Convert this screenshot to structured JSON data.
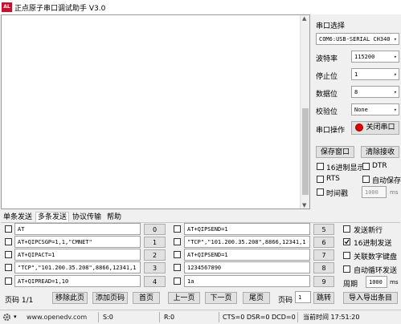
{
  "window": {
    "title": "正点原子串口调试助手 V3.0",
    "logo_text": "ALIENTEK"
  },
  "serial": {
    "section_title": "串口选择",
    "port": "COM6:USB-SERIAL CH340",
    "baud_label": "波特率",
    "baud": "115200",
    "stop_label": "停止位",
    "stop": "1",
    "data_label": "数据位",
    "data": "8",
    "parity_label": "校验位",
    "parity": "None",
    "op_label": "串口操作",
    "close_button": "关闭串口",
    "status_color": "#e00000"
  },
  "actions": {
    "save_window": "保存窗口",
    "clear_receive": "清除接收",
    "hex_display": "16进制显示",
    "dtr": "DTR",
    "rts": "RTS",
    "auto_save": "自动保存",
    "timestamp": "时间戳",
    "timestamp_value": "1000",
    "ms": "ms"
  },
  "tabs": [
    "单条发送",
    "多条发送",
    "协议传输",
    "帮助"
  ],
  "multi_send": {
    "rows": [
      {
        "text": "AT",
        "num": "0"
      },
      {
        "text": "AT+QIPCSGP=1,1,\"CMNET\"",
        "num": "1"
      },
      {
        "text": "AT+QIPACT=1",
        "num": "2"
      },
      {
        "text": "\"TCP\",\"101.200.35.208\",8866,12341,1",
        "num": "3"
      },
      {
        "text": "AT+QIPREAD=1,10",
        "num": "4"
      }
    ],
    "rows2": [
      {
        "text": "AT+QIPSEND=1",
        "num": "5"
      },
      {
        "text": "\"TCP\",\"101.200.35.208\",8866,12341,1",
        "num": "6"
      },
      {
        "text": "AT+QIPSEND=1",
        "num": "7"
      },
      {
        "text": "1234567890",
        "num": "8"
      },
      {
        "text": "1a",
        "num": "9"
      }
    ],
    "send_newline": "发送新行",
    "hex_send": "16进制发送",
    "link_keyboard": "关联数字键盘",
    "auto_loop": "自动循环发送",
    "period_label": "周期",
    "period_value": "1000",
    "ms": "ms"
  },
  "pager": {
    "page_label": "页码 1/1",
    "remove_page": "移除此页",
    "add_page": "添加页码",
    "first": "首页",
    "prev": "上一页",
    "next": "下一页",
    "last": "尾页",
    "page_text": "页码",
    "page_value": "1",
    "jump": "跳转",
    "import_export": "导入导出条目"
  },
  "status": {
    "url": "www.openedv.com",
    "s": "S:0",
    "r": "R:0",
    "signals": "CTS=0 DSR=0 DCD=0",
    "time": "当前时间 17:51:20"
  }
}
